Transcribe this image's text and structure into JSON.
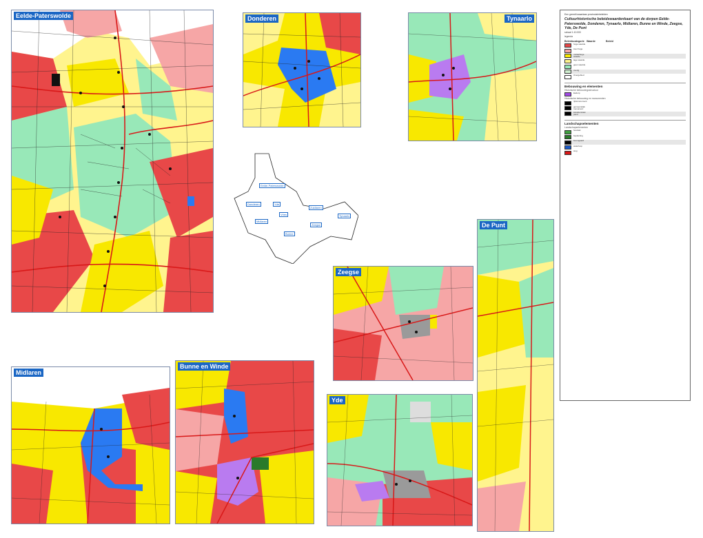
{
  "panels": {
    "eelde": "Eelde-Paterswolde",
    "donderen": "Donderen",
    "tynaarlo": "Tynaarlo",
    "depunt": "De Punt",
    "zeegse": "Zeegse",
    "midlaren": "Midlaren",
    "bunne": "Bunne en Winde",
    "yde": "Yde"
  },
  "overview_labels": [
    "Eelde-Paterswolde",
    "Donderen",
    "Yde",
    "Vries",
    "Zuidlaren",
    "Tynaarlo",
    "Zeegse",
    "Bunne",
    "Midlaren"
  ],
  "legend": {
    "super": "Een greedt kwaarlaas provincialebeleiden",
    "title": "Cultuurhistorische beleidswaardenkaart van de dorpen Eelde-Paterswolde, Donderen, Tynaarlo, Midlaren, Bunne en Winde, Zeegse, Yde, De Punt",
    "scale": "schaal 1:10.000",
    "legend_word": "legenda",
    "header": [
      "Beleidscategorie",
      "Waarde",
      "Beleid"
    ],
    "sections": [
      {
        "title": "",
        "rows": [
          {
            "name": "hoge waarde",
            "color": "#e84848"
          },
          {
            "name": "zeer hoge",
            "color": "#f6a6a6"
          },
          {
            "name": "middelhoge waarde",
            "color": "#f8e800"
          },
          {
            "name": "lage waarde",
            "color": "#fff48e"
          },
          {
            "name": "geen waarde",
            "color": "#98e8b8"
          },
          {
            "name": "overig",
            "color": "#cfeecf"
          },
          {
            "name": "Overgebied",
            "color": "#ffffff"
          }
        ]
      },
      {
        "title": "Bebouwing en elementen",
        "sub": "Historische bebouwingsstructuur",
        "rows": [
          {
            "name": "Esdorp",
            "color": "#a24ae6"
          }
        ]
      },
      {
        "title": "",
        "sub": "Historische bebouwing en monumenten",
        "rows": [
          {
            "name": "rijksmonument",
            "color": "#000000"
          },
          {
            "name": "gemeentelijk monument",
            "color": "#000000"
          },
          {
            "name": "karakteristiek pand",
            "color": "#000000"
          }
        ]
      },
      {
        "title": "Landschapselementen",
        "sub": "Landschapselementen",
        "rows": [
          {
            "name": "houtwal",
            "color": "#40a040"
          },
          {
            "name": "beplanting",
            "color": "#2a7a2a"
          },
          {
            "name": "boomgaard",
            "color": "#000000"
          },
          {
            "name": "waterloop",
            "color": "#1a5ac8"
          },
          {
            "name": "weg",
            "color": "#d81818"
          }
        ]
      }
    ]
  },
  "colors": {
    "red": "#e84848",
    "pink": "#f6a6a6",
    "yellow": "#f8e800",
    "lightyellow": "#fff48e",
    "green": "#98e8b8",
    "purple": "#b97bf0",
    "blue": "#2a7af2",
    "gray": "#9a9a9a",
    "road": "#d81818",
    "line": "#222222"
  }
}
